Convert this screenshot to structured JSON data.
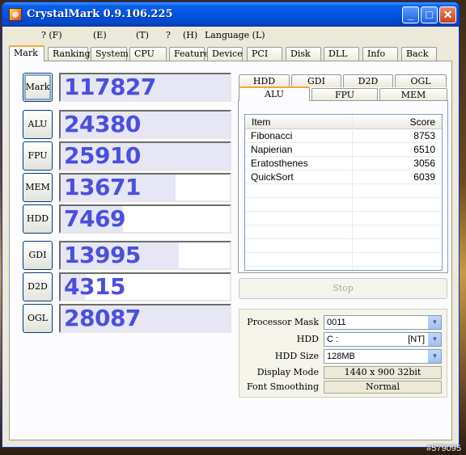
{
  "window": {
    "title": "CrystalMark 0.9.106.225"
  },
  "window_buttons": {
    "minimize": "_",
    "maximize": "□",
    "close": "✕"
  },
  "menu": [
    "? (F)",
    "(E)",
    "(T)",
    "?",
    "(H)",
    "Language (L)"
  ],
  "tabs": [
    "Mark",
    "Ranking",
    "System",
    "CPU",
    "Feature",
    "Device",
    "PCI",
    "Disk",
    "DLL",
    "Info",
    "Back"
  ],
  "scores": [
    {
      "label": "Mark",
      "value": "117827",
      "fraction": 1.0
    },
    {
      "label": "ALU",
      "value": "24380",
      "fraction": 1.0
    },
    {
      "label": "FPU",
      "value": "25910",
      "fraction": 1.0
    },
    {
      "label": "MEM",
      "value": "13671",
      "fraction": 0.68
    },
    {
      "label": "HDD",
      "value": "7469",
      "fraction": 0.37
    },
    {
      "label": "GDI",
      "value": "13995",
      "fraction": 0.7
    },
    {
      "label": "D2D",
      "value": "4315",
      "fraction": 0.15
    },
    {
      "label": "OGL",
      "value": "28087",
      "fraction": 1.0
    }
  ],
  "subtabs_top": [
    "HDD",
    "GDI",
    "D2D",
    "OGL"
  ],
  "subtabs_bottom": [
    "ALU",
    "FPU",
    "MEM"
  ],
  "table": {
    "headers": [
      "Item",
      "Score"
    ],
    "rows": [
      [
        "Fibonacci",
        "8753"
      ],
      [
        "Napierian",
        "6510"
      ],
      [
        "Eratosthenes",
        "3056"
      ],
      [
        "QuickSort",
        "6039"
      ]
    ]
  },
  "stop_label": "Stop",
  "settings": {
    "processor_mask": {
      "label": "Processor Mask",
      "value": "0011"
    },
    "hdd": {
      "label": "HDD",
      "value": "C :",
      "tag": "[NT]"
    },
    "hdd_size": {
      "label": "HDD Size",
      "value": "128MB"
    },
    "display_mode": {
      "label": "Display Mode",
      "value": "1440 x 900 32bit"
    },
    "font_smoothing": {
      "label": "Font Smoothing",
      "value": "Normal"
    }
  },
  "watermark": "#579095"
}
